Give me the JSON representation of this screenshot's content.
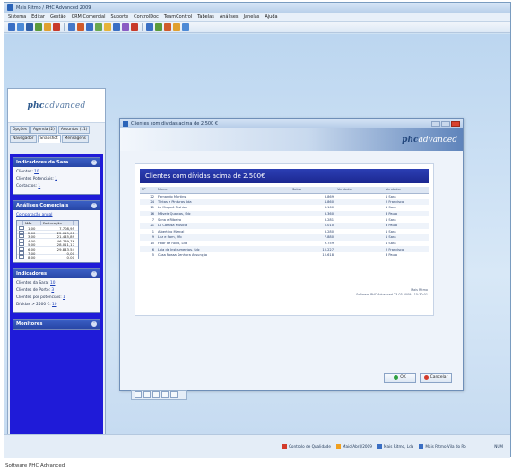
{
  "app": {
    "title": "Mais Ritmo / PHC Advanced 2009",
    "menu": [
      "Sistema",
      "Editar",
      "Gestão",
      "CRM Comercial",
      "Suporte",
      "ControlDoc",
      "TeamControl",
      "Tabelas",
      "Análises",
      "Janelas",
      "Ajuda"
    ]
  },
  "left_panel": {
    "logo": {
      "prefix": "phc",
      "suffix": "advanced"
    },
    "tabs": [
      "Opções",
      "Agenda (2)",
      "Assuntos (11)",
      "Navegador",
      "Snapshot",
      "Mensagens"
    ],
    "active_tab": "Snapshot",
    "sections": {
      "sara": {
        "title": "Indicadores da Sara",
        "items": [
          {
            "label": "Clientes:",
            "value": "10"
          },
          {
            "label": "Clientes Potenciais:",
            "value": "1"
          },
          {
            "label": "Contactos:",
            "value": "1"
          }
        ]
      },
      "comercial": {
        "title": "Análises Comerciais",
        "link": "Comparação anual",
        "grid_headers": [
          "Mês",
          "Facturação"
        ],
        "grid_rows": [
          {
            "mes": "1,00",
            "valor": "7.708,95"
          },
          {
            "mes": "2,00",
            "valor": "22.015,01"
          },
          {
            "mes": "3,00",
            "valor": "21.445,89"
          },
          {
            "mes": "4,00",
            "valor": "46.789,76"
          },
          {
            "mes": "5,00",
            "valor": "28.011,17"
          },
          {
            "mes": "6,00",
            "valor": "29.843,54"
          },
          {
            "mes": "7,00",
            "valor": "0,00"
          },
          {
            "mes": "8,00",
            "valor": "0,00"
          }
        ]
      },
      "indicadores": {
        "title": "Indicadores",
        "items": [
          {
            "label": "Clientes da Sara:",
            "value": "10"
          },
          {
            "label": "Clientes de Porto:",
            "value": "3"
          },
          {
            "label": "Clientes por potenciais:",
            "value": "1"
          },
          {
            "label": "Dívidas > 2500 €:",
            "value": "10"
          }
        ]
      },
      "monitores": {
        "title": "Monitores"
      }
    }
  },
  "dialog": {
    "title": "Clientes com dividas acima de 2.500 €",
    "brand": {
      "prefix": "phc",
      "suffix": "advanced"
    },
    "report_title": "Clientes com dívidas acima de 2.500€",
    "columns": [
      "Nº",
      "Nome",
      "Saldo",
      "Vendedor",
      "Vendedor"
    ],
    "rows": [
      {
        "no": "22",
        "nome": "Fernando Martins",
        "saldo": "3.869",
        "vend": "1 Sara"
      },
      {
        "no": "24",
        "nome": "Tintas e Pinturas Lda",
        "saldo": "4.860",
        "vend": "2 Francisco"
      },
      {
        "no": "11",
        "nome": "La Maçaró Fashion",
        "saldo": "3.160",
        "vend": "1 Sara"
      },
      {
        "no": "16",
        "nome": "Móveis Quartos, Sdc",
        "saldo": "3.360",
        "vend": "3 Paulo"
      },
      {
        "no": "7",
        "nome": "Sena e Ribeiro",
        "saldo": "3.281",
        "vend": "1 Sara"
      },
      {
        "no": "21",
        "nome": "La Camisa Musical",
        "saldo": "5.010",
        "vend": "3 Paulo"
      },
      {
        "no": "1",
        "nome": "Albertino Marçal",
        "saldo": "3.280",
        "vend": "1 Sara"
      },
      {
        "no": "9",
        "nome": "Luz e Som, Sfb",
        "saldo": "7.880",
        "vend": "1 Sara"
      },
      {
        "no": "15",
        "nome": "Falar de novo, Lda",
        "saldo": "9.759",
        "vend": "1 Sara"
      },
      {
        "no": "6",
        "nome": "Loja de Instrumentos, Sdc",
        "saldo": "10.227",
        "vend": "2 Francisco"
      },
      {
        "no": "5",
        "nome": "Casa Nossa Senhora Assunção",
        "saldo": "10.618",
        "vend": "3 Paulo"
      }
    ],
    "footer_lines": [
      "Mais Ritmo",
      "Software PHC Advanced 23.03.2009 - 15:30:01"
    ],
    "ok_label": "OK",
    "cancel_label": "Cancelar"
  },
  "taskbar": [
    {
      "label": "Controlo de Qualidade",
      "color": "#d33b2b"
    },
    {
      "label": "Maio/Abril/2009",
      "color": "#f0a020"
    },
    {
      "label": "Mais Ritmo, Lda",
      "color": "#3a6fc4"
    },
    {
      "label": "Mais Ritmo Vila do Ro",
      "color": "#3a6fc4"
    }
  ],
  "status_right": "NUM",
  "caption": "Software PHC Advanced"
}
